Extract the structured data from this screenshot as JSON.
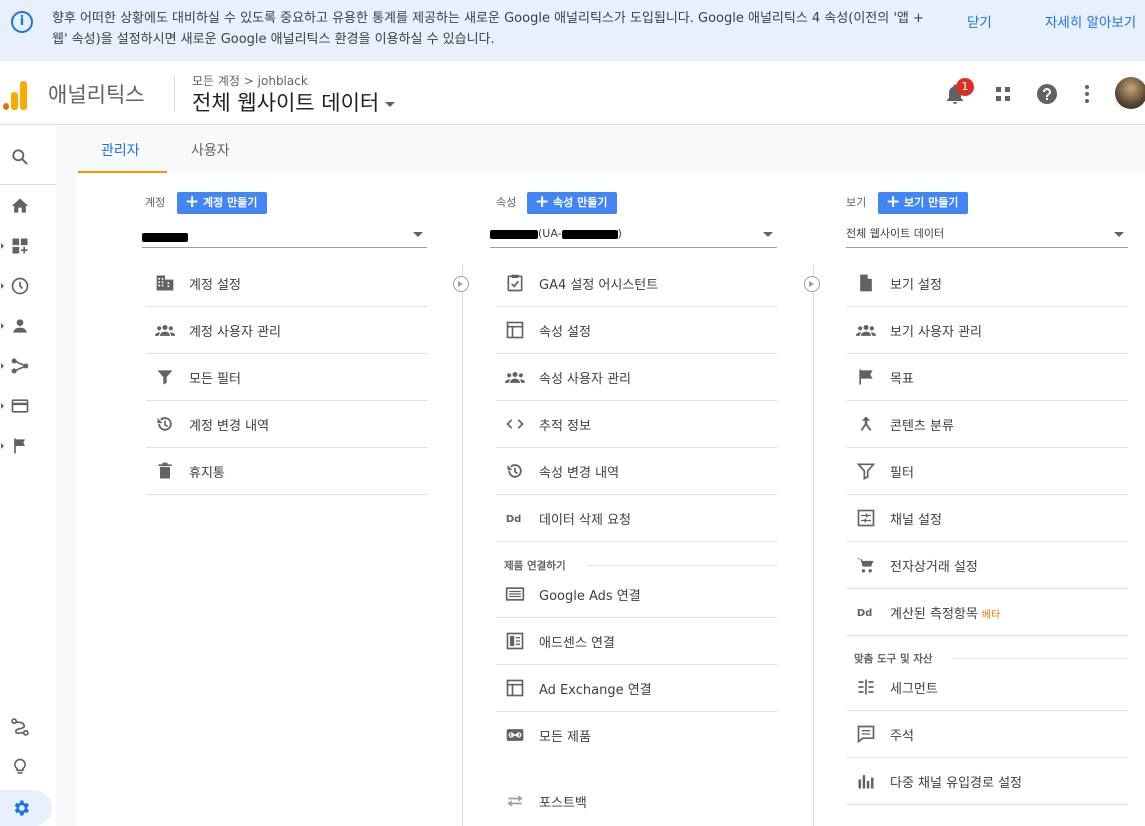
{
  "banner": {
    "message": "향후 어떠한 상황에도 대비하실 수 있도록 중요하고 유용한 통계를 제공하는 새로운 Google 애널리틱스가 도입됩니다. Google 애널리틱스 4 속성(이전의 '앱 + 웹' 속성)을 설정하시면 새로운 Google 애널리틱스 환경을 이용하실 수 있습니다.",
    "close_label": "닫기",
    "more_label": "자세히 알아보기"
  },
  "header": {
    "app_name": "애널리틱스",
    "breadcrumb": "모든 계정 > johblack",
    "property_title": "전체 웹사이트 데이터",
    "notification_count": "1"
  },
  "tabs": {
    "admin": "관리자",
    "user": "사용자"
  },
  "account": {
    "heading": "계정",
    "create_label": "계정 만들기",
    "items": [
      {
        "label": "계정 설정"
      },
      {
        "label": "계정 사용자 관리"
      },
      {
        "label": "모든 필터"
      },
      {
        "label": "계정 변경 내역"
      },
      {
        "label": "휴지통"
      }
    ]
  },
  "property": {
    "heading": "속성",
    "create_label": "속성 만들기",
    "select_value": "(UA-",
    "select_suffix": ")",
    "items": [
      {
        "label": "GA4 설정 어시스턴트"
      },
      {
        "label": "속성 설정"
      },
      {
        "label": "속성 사용자 관리"
      },
      {
        "label": "추적 정보"
      },
      {
        "label": "속성 변경 내역"
      },
      {
        "label": "데이터 삭제 요청"
      }
    ],
    "section_label": "제품 연결하기",
    "link_items": [
      {
        "label": "Google Ads 연결"
      },
      {
        "label": "애드센스 연결"
      },
      {
        "label": "Ad Exchange 연결"
      },
      {
        "label": "모든 제품"
      },
      {
        "label": "포스트백"
      }
    ]
  },
  "view": {
    "heading": "보기",
    "create_label": "보기 만들기",
    "select_value": "전체 웹사이트 데이터",
    "items": [
      {
        "label": "보기 설정"
      },
      {
        "label": "보기 사용자 관리"
      },
      {
        "label": "목표"
      },
      {
        "label": "콘텐츠 분류"
      },
      {
        "label": "필터"
      },
      {
        "label": "채널 설정"
      },
      {
        "label": "전자상거래 설정"
      },
      {
        "label": "계산된 측정항목",
        "badge": "베타"
      }
    ],
    "section_label": "맞춤 도구 및 자산",
    "tool_items": [
      {
        "label": "세그먼트"
      },
      {
        "label": "주석"
      },
      {
        "label": "다중 채널 유입경로 설정"
      }
    ]
  }
}
